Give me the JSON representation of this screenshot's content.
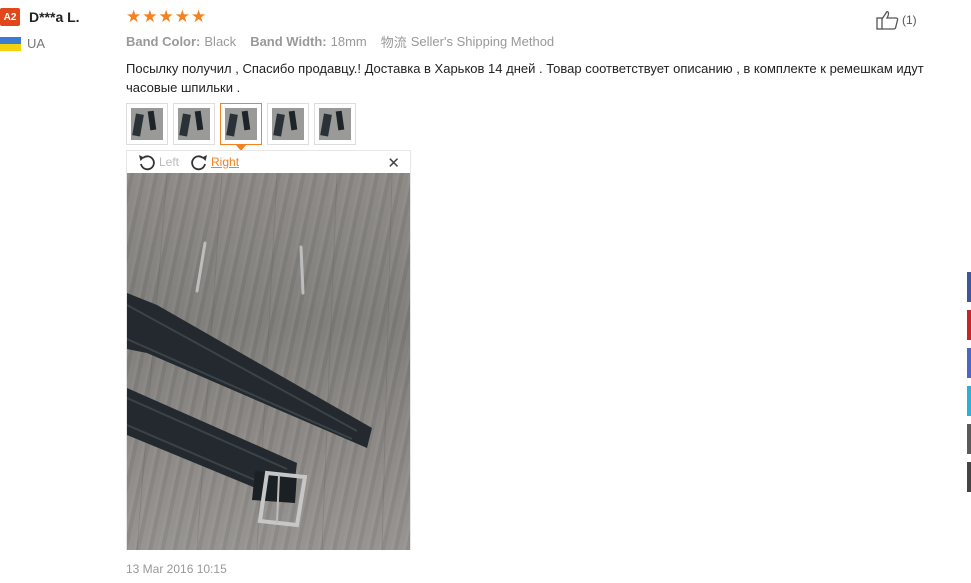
{
  "reviewer": {
    "level_badge": "A2",
    "name": "D***a L.",
    "country": "UA"
  },
  "rating": {
    "stars": 5,
    "max": 5,
    "star_glyph": "★"
  },
  "attributes": [
    {
      "key": "Band Color:",
      "value": "Black"
    },
    {
      "key": "Band Width:",
      "value": "18mm"
    }
  ],
  "shipping": {
    "label": "物流",
    "value": "Seller's Shipping Method"
  },
  "review_text": "Посылку получил , Спасибо продавцу.! Доставка в Харьков 14 дней . Товар соответствует описанию , в комплекте к ремешкам идут часовые шпильки .",
  "thumbnails": [
    {
      "name": "photo-1",
      "active": false
    },
    {
      "name": "photo-2",
      "active": false
    },
    {
      "name": "photo-3",
      "active": true
    },
    {
      "name": "photo-4",
      "active": false
    },
    {
      "name": "photo-5",
      "active": false
    }
  ],
  "viewer": {
    "rotate_left_label": "Left",
    "rotate_right_label": "Right",
    "close_glyph": "✕"
  },
  "timestamp": "13 Mar 2016 10:15",
  "helpful": {
    "count_label": "(1)"
  },
  "colors": {
    "accent": "#f5811f",
    "badge": "#e2471b",
    "side_tabs": [
      "#3b5998",
      "#cc2127",
      "#4a67c7",
      "#29b1d8",
      "#5a5a5a",
      "#444444"
    ]
  }
}
